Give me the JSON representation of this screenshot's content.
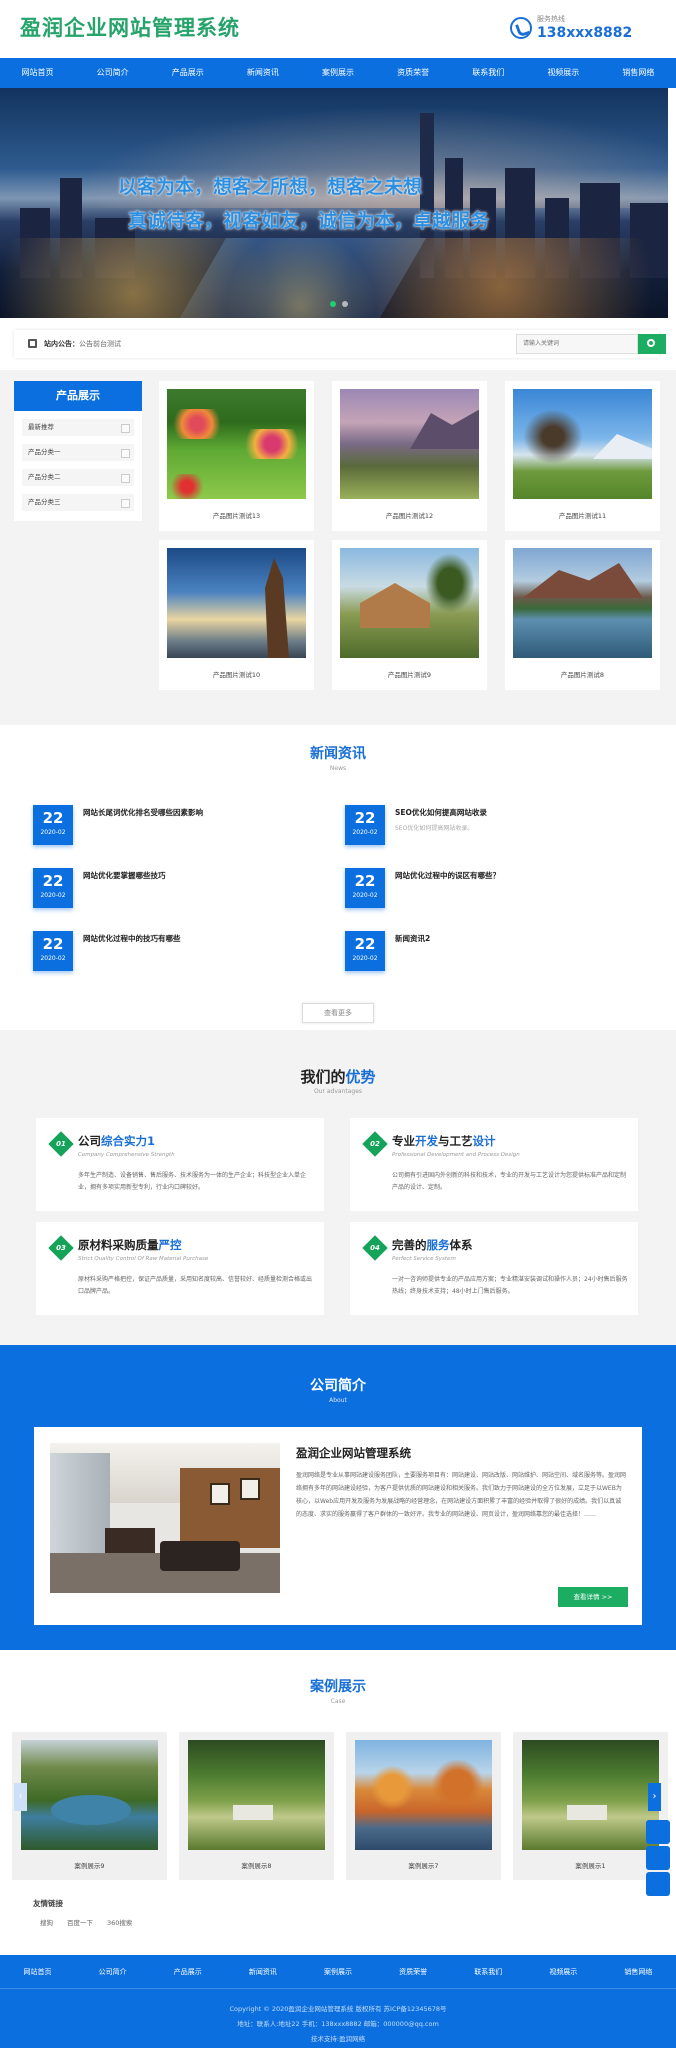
{
  "header": {
    "logo": "盈润企业网站管理系统",
    "hotline_label": "服务热线",
    "hotline_number": "138xxx8882"
  },
  "nav": [
    "网站首页",
    "公司简介",
    "产品展示",
    "新闻资讯",
    "案例展示",
    "资质荣誉",
    "联系我们",
    "视频展示",
    "销售网络"
  ],
  "banner": {
    "slogan1": "以客为本，想客之所想，想客之未想",
    "slogan2": "真诚待客，视客如友，诚信为本，卓越服务"
  },
  "notice": {
    "label": "站内公告：",
    "text": "公告前台测试"
  },
  "search": {
    "placeholder": "请输入关键词"
  },
  "products": {
    "title": "产品展示",
    "categories": [
      "最新推荐",
      "产品分类一",
      "产品分类二",
      "产品分类三"
    ],
    "items": [
      {
        "caption": "产品图片测试13"
      },
      {
        "caption": "产品图片测试12"
      },
      {
        "caption": "产品图片测试11"
      },
      {
        "caption": "产品图片测试10"
      },
      {
        "caption": "产品图片测试9"
      },
      {
        "caption": "产品图片测试8"
      }
    ]
  },
  "news": {
    "title": "新闻资讯",
    "subtitle": "News",
    "items": [
      {
        "day": "22",
        "month": "2020-02",
        "title": "网站长尾词优化排名受哪些因素影响",
        "desc": ""
      },
      {
        "day": "22",
        "month": "2020-02",
        "title": "SEO优化如何提高网站收录",
        "desc": "SEO优化如何提高网站收录。"
      },
      {
        "day": "22",
        "month": "2020-02",
        "title": "网站优化要掌握哪些技巧",
        "desc": ""
      },
      {
        "day": "22",
        "month": "2020-02",
        "title": "网站优化过程中的误区有哪些？",
        "desc": ""
      },
      {
        "day": "22",
        "month": "2020-02",
        "title": "网站优化过程中的技巧有哪些",
        "desc": ""
      },
      {
        "day": "22",
        "month": "2020-02",
        "title": "新闻资讯2",
        "desc": ""
      }
    ],
    "more": "查看更多"
  },
  "advantages": {
    "title_a": "我们的",
    "title_b": "优势",
    "subtitle": "Our advantages",
    "items": [
      {
        "num": "01",
        "t1": "公司",
        "t2": "综合实力",
        "t3": "1",
        "en": "Company Comprehensive Strength",
        "desc": "多年生产制造、设备销售、售后服务、技术服务为一体的生产企业；科技型企业入单企业，拥有多项实用新型专利，行业内口碑较好。"
      },
      {
        "num": "02",
        "t1": "专业",
        "t2": "开发",
        "t3": "与工艺",
        "t4": "设计",
        "en": "Professional Development and Process Design",
        "desc": "公司拥有引进国内外创新的科技和技术，专业的开发与工艺设计为您提供标准产品和定制产品的设计、定制。"
      },
      {
        "num": "03",
        "t1": "原材料采购质量",
        "t2": "严控",
        "t3": "",
        "en": "Strict Quality Control Of Raw Material Purchase",
        "desc": "原材料采购严格把控，保证产品质量，采用知名度较高、信誉较好、经质量检测合格或出口品牌产品。"
      },
      {
        "num": "04",
        "t1": "完善的",
        "t2": "服务",
        "t3": "体系",
        "en": "Perfect Service System",
        "desc": "一对一咨询师提供专业的产品应用方案；专业精湛安装调试和操作人员；24小时售后服务热线；终身技术支持；48小时上门售后服务。"
      }
    ]
  },
  "about": {
    "title": "公司简介",
    "subtitle": "About",
    "heading": "盈润企业网站管理系统",
    "text": "盈润网络是专业从事网站建设服务团队，主要服务项目有：网站建设、网站改版、网站维护、网站空间、域名服务等。盈润网络拥有多年的网站建设经验，为客户提供优质的网站建设和相关服务。我们致力于网站建设的全方位发展，立足于以WEB为核心，以Web应用开发及服务为发展战略的经营理念，在网站建设方面积累了丰富的经验并取得了很好的成绩。我们以真诚的态度、求实的服务赢得了客户群体的一致好评。我专业的网站建设、网页设计，盈润网络靠您的最佳选择！……",
    "btn": "查看详情 >>"
  },
  "cases": {
    "title": "案例展示",
    "subtitle": "Case",
    "items": [
      {
        "caption": "案例展示9"
      },
      {
        "caption": "案例展示8"
      },
      {
        "caption": "案例展示7"
      },
      {
        "caption": "案例展示1"
      }
    ],
    "prev": "‹",
    "next": "›"
  },
  "friend_links": {
    "title": "友情链接",
    "items": [
      "搜狗",
      "百度一下",
      "360搜索"
    ]
  },
  "footer": {
    "nav": [
      "网站首页",
      "公司简介",
      "产品展示",
      "新闻资讯",
      "案例展示",
      "资质荣誉",
      "联系我们",
      "视频展示",
      "销售网络"
    ],
    "copyright": "Copyright © 2020盈润企业网站管理系统 版权所有 苏ICP备12345678号",
    "contact": "地址：联系人:地址22 手机：138xxx8882 邮箱：000000@qq.com",
    "support": "技术支持:盈润网络"
  },
  "colors": {
    "brand_blue": "#0b6fe0",
    "accent_green": "#1cad62",
    "logo_green": "#25a36a"
  }
}
